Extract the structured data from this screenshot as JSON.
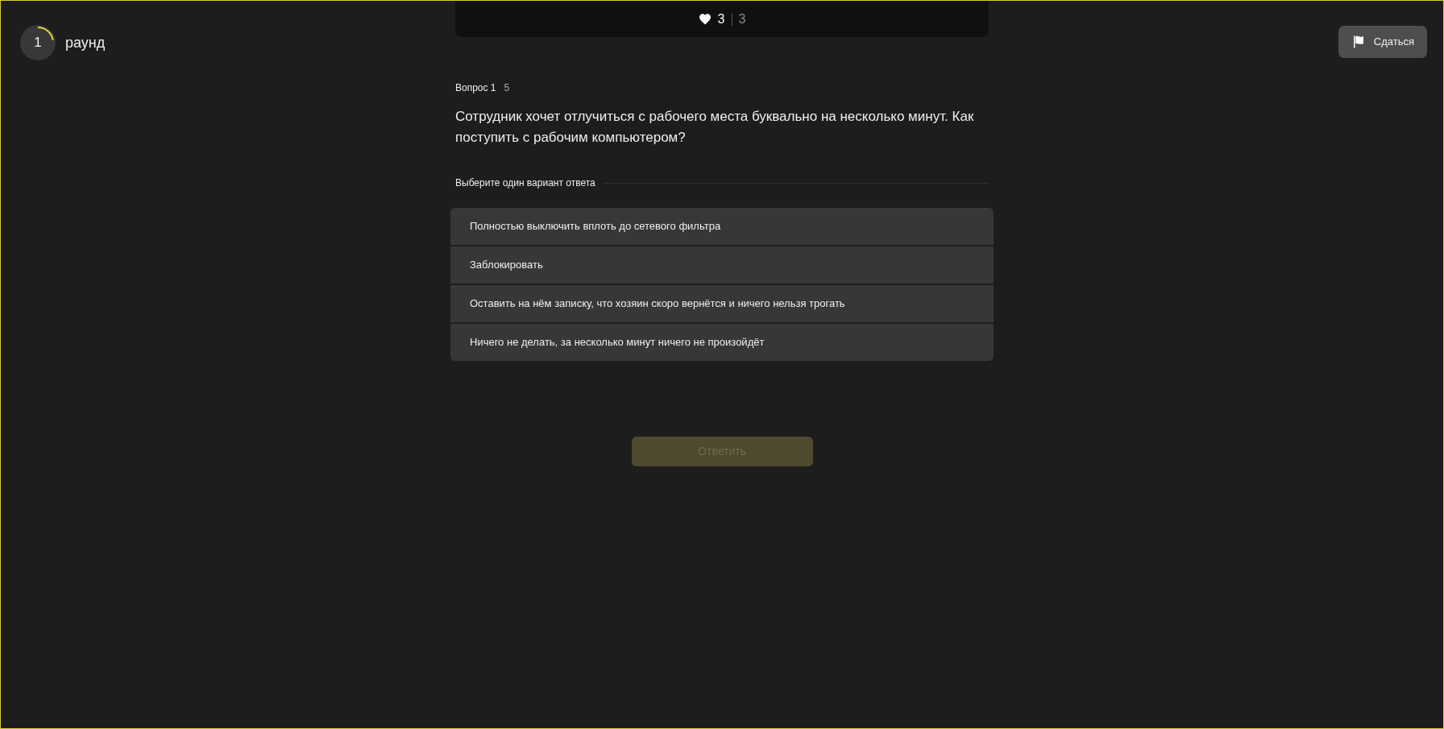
{
  "round": {
    "number": "1",
    "label": "раунд"
  },
  "surrender_button": {
    "label": "Сдаться"
  },
  "lives": {
    "current": "3",
    "total": "3"
  },
  "question": {
    "label": "Вопрос 1",
    "points": "5",
    "text": "Сотрудник хочет отлучиться с рабочего места буквально на несколько минут. Как поступить с рабочим компьютером?"
  },
  "instruction": "Выберите один вариант ответа",
  "options": [
    {
      "label": "Полностью выключить вплоть до сетевого фильтра",
      "selected": false
    },
    {
      "label": "Заблокировать",
      "selected": false
    },
    {
      "label": "Оставить на нём записку, что хозяин скоро вернётся и ничего нельзя трогать",
      "selected": false
    },
    {
      "label": "Ничего не делать, за несколько минут ничего не произойдёт",
      "selected": false
    }
  ],
  "submit_button": {
    "label": "Ответить",
    "disabled": true
  }
}
